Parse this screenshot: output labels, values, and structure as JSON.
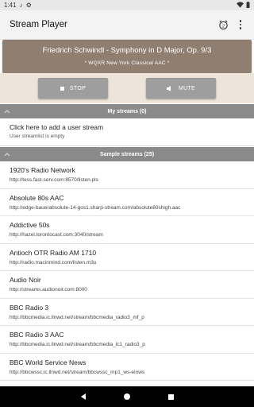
{
  "status_bar": {
    "time": "1:41"
  },
  "app_bar": {
    "title": "Stream Player"
  },
  "now_playing": {
    "title": "Friedrich Schwindl - Symphony in D Major, Op. 9/3",
    "station": "* WQXR New York Classical AAC *"
  },
  "controls": {
    "stop_label": "STOP",
    "mute_label": "MUTE"
  },
  "my_streams": {
    "header": "My streams (0)",
    "add_title": "Click here to add a user stream",
    "add_subtitle": "User streamlist is empty"
  },
  "sample_streams": {
    "header": "Sample streams (25)",
    "items": [
      {
        "name": "1920's Radio Network",
        "url": "http://tess.fast-serv.com:8570/listen.pls"
      },
      {
        "name": "Absolute 80s AAC",
        "url": "http://edge-bauerabsolute-14-gos1.sharp-stream.com/absolute80shigh.aac"
      },
      {
        "name": "Addictive 50s",
        "url": "http://hazel.torontocast.com:3040/stream"
      },
      {
        "name": "Antioch OTR Radio AM 1710",
        "url": "http://radio.macinmind.com/listen.m3u"
      },
      {
        "name": "Audio Noir",
        "url": "http://streams.audionoir.com:8000"
      },
      {
        "name": "BBC Radio 3",
        "url": "http://bbcmedia.ic.llnwd.net/stream/bbcmedia_radio3_mf_p"
      },
      {
        "name": "BBC Radio 3 AAC",
        "url": "http://bbcmedia.ic.llnwd.net/stream/bbcmedia_lc1_radio3_p"
      },
      {
        "name": "BBC World Service News",
        "url": "http://bbcwssc.ic.llnwd.net/stream/bbcwssc_mp1_ws-einws"
      }
    ]
  },
  "colors": {
    "now_playing_bg": "#907f71",
    "controls_bg": "#ede4da",
    "button_bg": "#9e9e9e",
    "section_header_bg": "#8a8a8a"
  }
}
